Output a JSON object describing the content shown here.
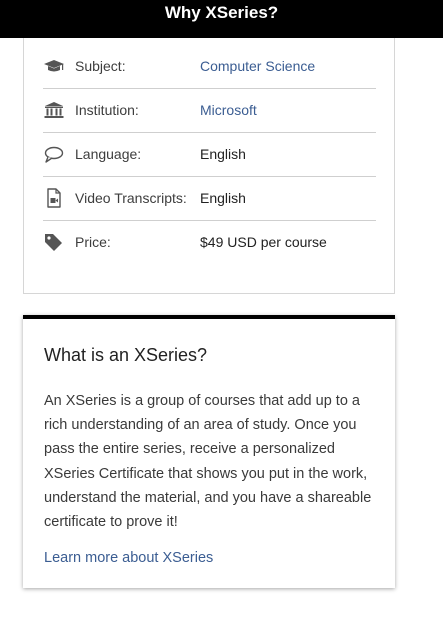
{
  "header": {
    "title": "Why XSeries?"
  },
  "details": [
    {
      "icon": "graduation-cap-icon",
      "label": "Subject:",
      "value": "Computer Science",
      "is_link": true
    },
    {
      "icon": "institution-icon",
      "label": "Institution:",
      "value": "Microsoft",
      "is_link": true
    },
    {
      "icon": "speech-bubble-icon",
      "label": "Language:",
      "value": "English",
      "is_link": false
    },
    {
      "icon": "video-file-icon",
      "label": "Video Transcripts:",
      "value": "English",
      "is_link": false
    },
    {
      "icon": "price-tag-icon",
      "label": "Price:",
      "value": "$49 USD per course",
      "is_link": false
    }
  ],
  "xseries_info": {
    "heading": "What is an XSeries?",
    "body": "An XSeries is a group of courses that add up to a rich understanding of an area of study. Once you pass the entire series, receive a personalized XSeries Certificate that shows you put in the work, understand the material, and you have a shareable certificate to prove it!",
    "link_label": "Learn more about XSeries"
  },
  "colors": {
    "link": "#3b5d92",
    "header_bg": "#000000",
    "icon": "#555555"
  }
}
